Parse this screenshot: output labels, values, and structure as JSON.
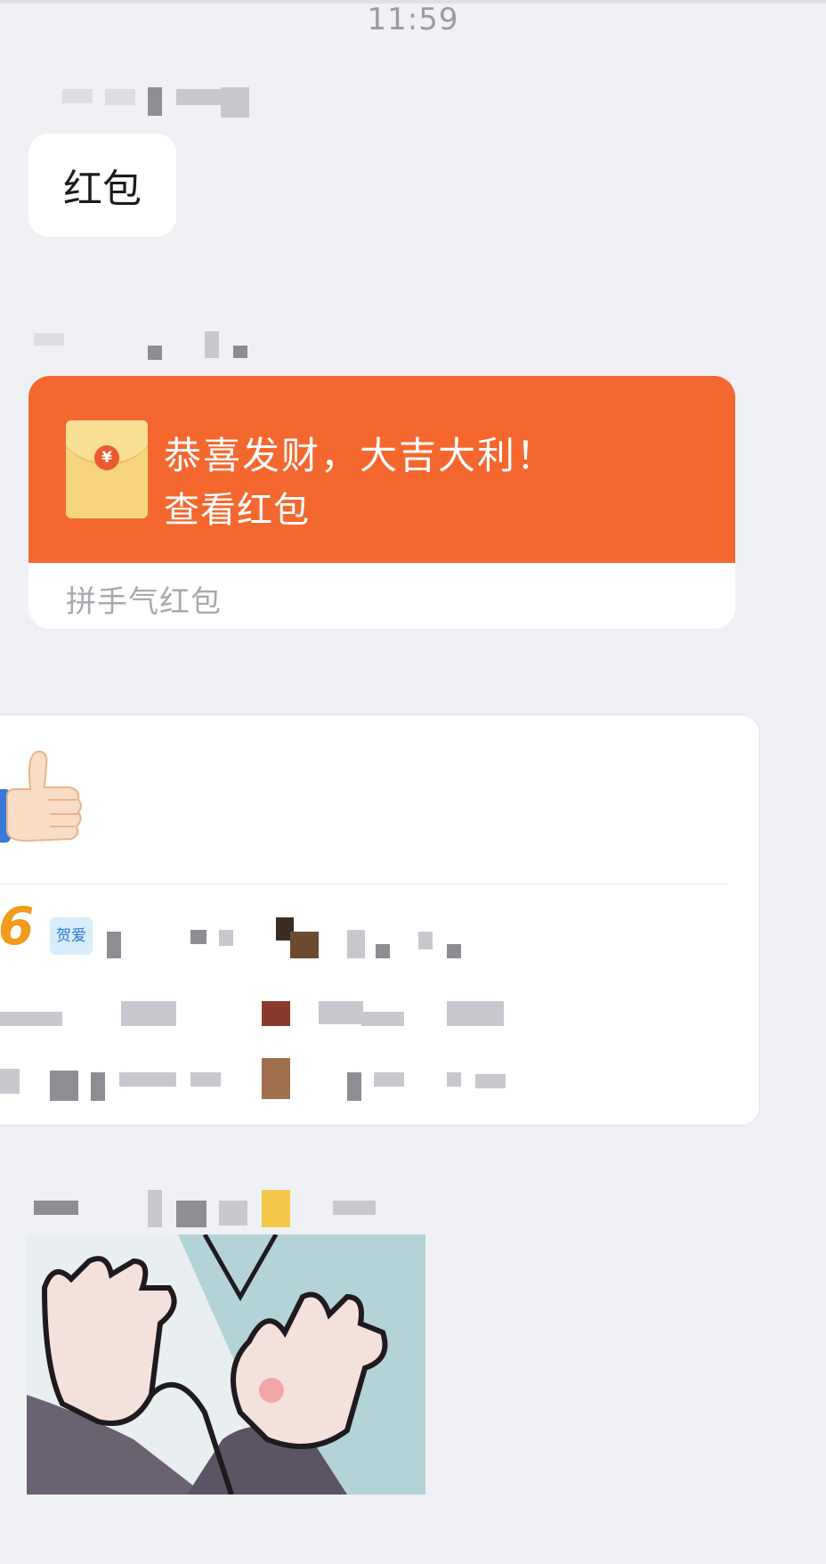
{
  "status": {
    "time": "11:59"
  },
  "messages": {
    "text_message": "红包",
    "red_packet": {
      "currency_symbol": "¥",
      "greeting": "恭喜发财，大吉大利！",
      "action": "查看红包",
      "type_label": "拼手气红包"
    },
    "ranking_card": {
      "rank_number": "6",
      "badge": "贺爱"
    }
  },
  "icons": {
    "red_packet": "red-envelope-icon",
    "thumbs_up": "thumbs-up-emoji",
    "avatar_sticker": "cartoon-sticker-image"
  },
  "colors": {
    "background": "#eff1f5",
    "red_packet_orange": "#f46830",
    "envelope_yellow": "#f7d57e",
    "rank_orange": "#f29a1a",
    "badge_blue": "#2d7ad6"
  }
}
